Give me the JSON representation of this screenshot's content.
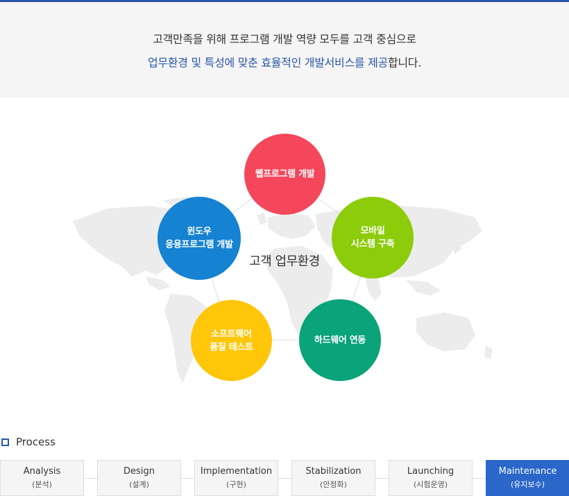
{
  "intro": {
    "line1": "고객만족을 위해 프로그램 개발 역량 모두를 고객 중심으로",
    "line2_highlight": "업무환경 및 특성에 맞춘 효율적인 개발서비스를 제공",
    "line2_rest": "합니다."
  },
  "diagram": {
    "center_label": "고객 업무환경",
    "nodes": [
      {
        "id": "web",
        "label": "웹프로그램 개발",
        "color": "#f4475b"
      },
      {
        "id": "mobile",
        "label": "모바일\n시스템 구축",
        "color": "#8ccc0a"
      },
      {
        "id": "hardware",
        "label": "하드웨어 연동",
        "color": "#0aa37a"
      },
      {
        "id": "qa",
        "label": "소프트웨어\n품질 테스트",
        "color": "#ffc60a"
      },
      {
        "id": "windows",
        "label": "윈도우\n응용프로그램 개발",
        "color": "#1582d2"
      }
    ]
  },
  "process": {
    "title": "Process",
    "steps": [
      {
        "en": "Analysis",
        "ko": "(분석)",
        "active": false
      },
      {
        "en": "Design",
        "ko": "(설계)",
        "active": false
      },
      {
        "en": "Implementation",
        "ko": "(구현)",
        "active": false
      },
      {
        "en": "Stabilization",
        "ko": "(안정화)",
        "active": false
      },
      {
        "en": "Launching",
        "ko": "(시험운영)",
        "active": false
      },
      {
        "en": "Maintenance",
        "ko": "(유지보수)",
        "active": true
      }
    ]
  }
}
